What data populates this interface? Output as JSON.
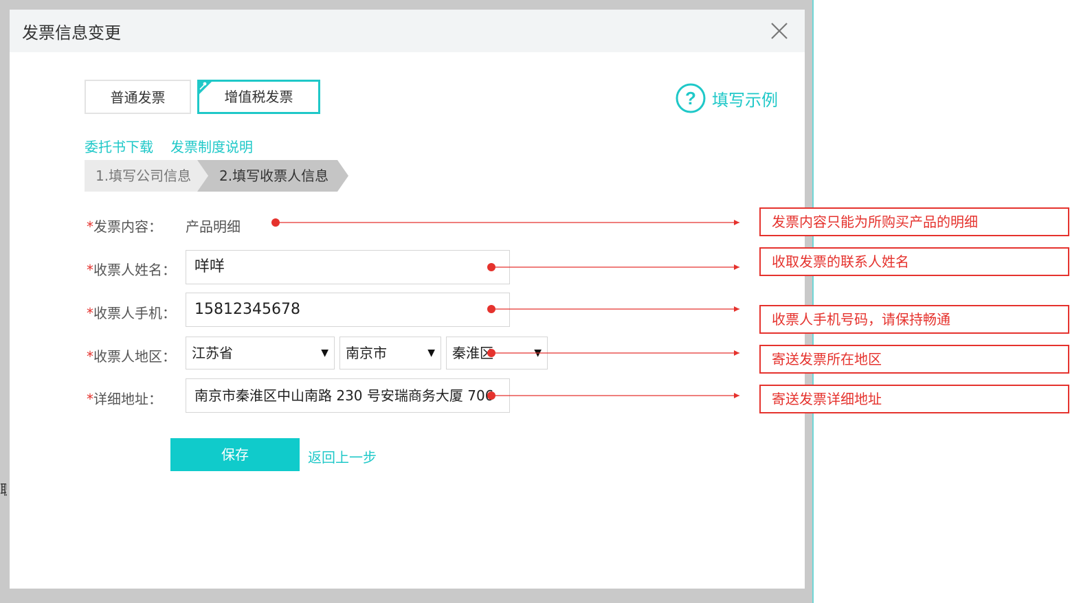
{
  "dialog": {
    "title": "发票信息变更",
    "tabs": [
      {
        "label": "普通发票",
        "active": false
      },
      {
        "label": "增值税发票",
        "active": true
      }
    ],
    "example_link": "填写示例",
    "links": [
      "委托书下载",
      "发票制度说明"
    ],
    "steps": [
      "1.填写公司信息",
      "2.填写收票人信息"
    ],
    "active_step": 2,
    "required_mark": "*",
    "form": {
      "content": {
        "label": "发票内容：",
        "value": "产品明细"
      },
      "name": {
        "label": "收票人姓名：",
        "value": "咩咩"
      },
      "phone": {
        "label": "收票人手机：",
        "value": "15812345678"
      },
      "region": {
        "label": "收票人地区：",
        "province": "江苏省",
        "city": "南京市",
        "district": "秦淮区"
      },
      "address": {
        "label": "详细地址：",
        "value": "南京市秦淮区中山南路 230 号安瑞商务大厦 706"
      }
    },
    "save_label": "保存",
    "back_label": "返回上一步"
  },
  "annotations": [
    "发票内容只能为所购买产品的明细",
    "收取发票的联系人姓名",
    "收票人手机号码，请保持畅通",
    "寄送发票所在地区",
    "寄送发票详细地址"
  ],
  "backdrop_glyph": "职",
  "colors": {
    "accent": "#1fc8c8",
    "button": "#10cbcb",
    "annotation": "#e5322d",
    "header_bg": "#f2f4f5",
    "step_active": "#c5c5c5",
    "step_inactive": "#ebebeb"
  }
}
